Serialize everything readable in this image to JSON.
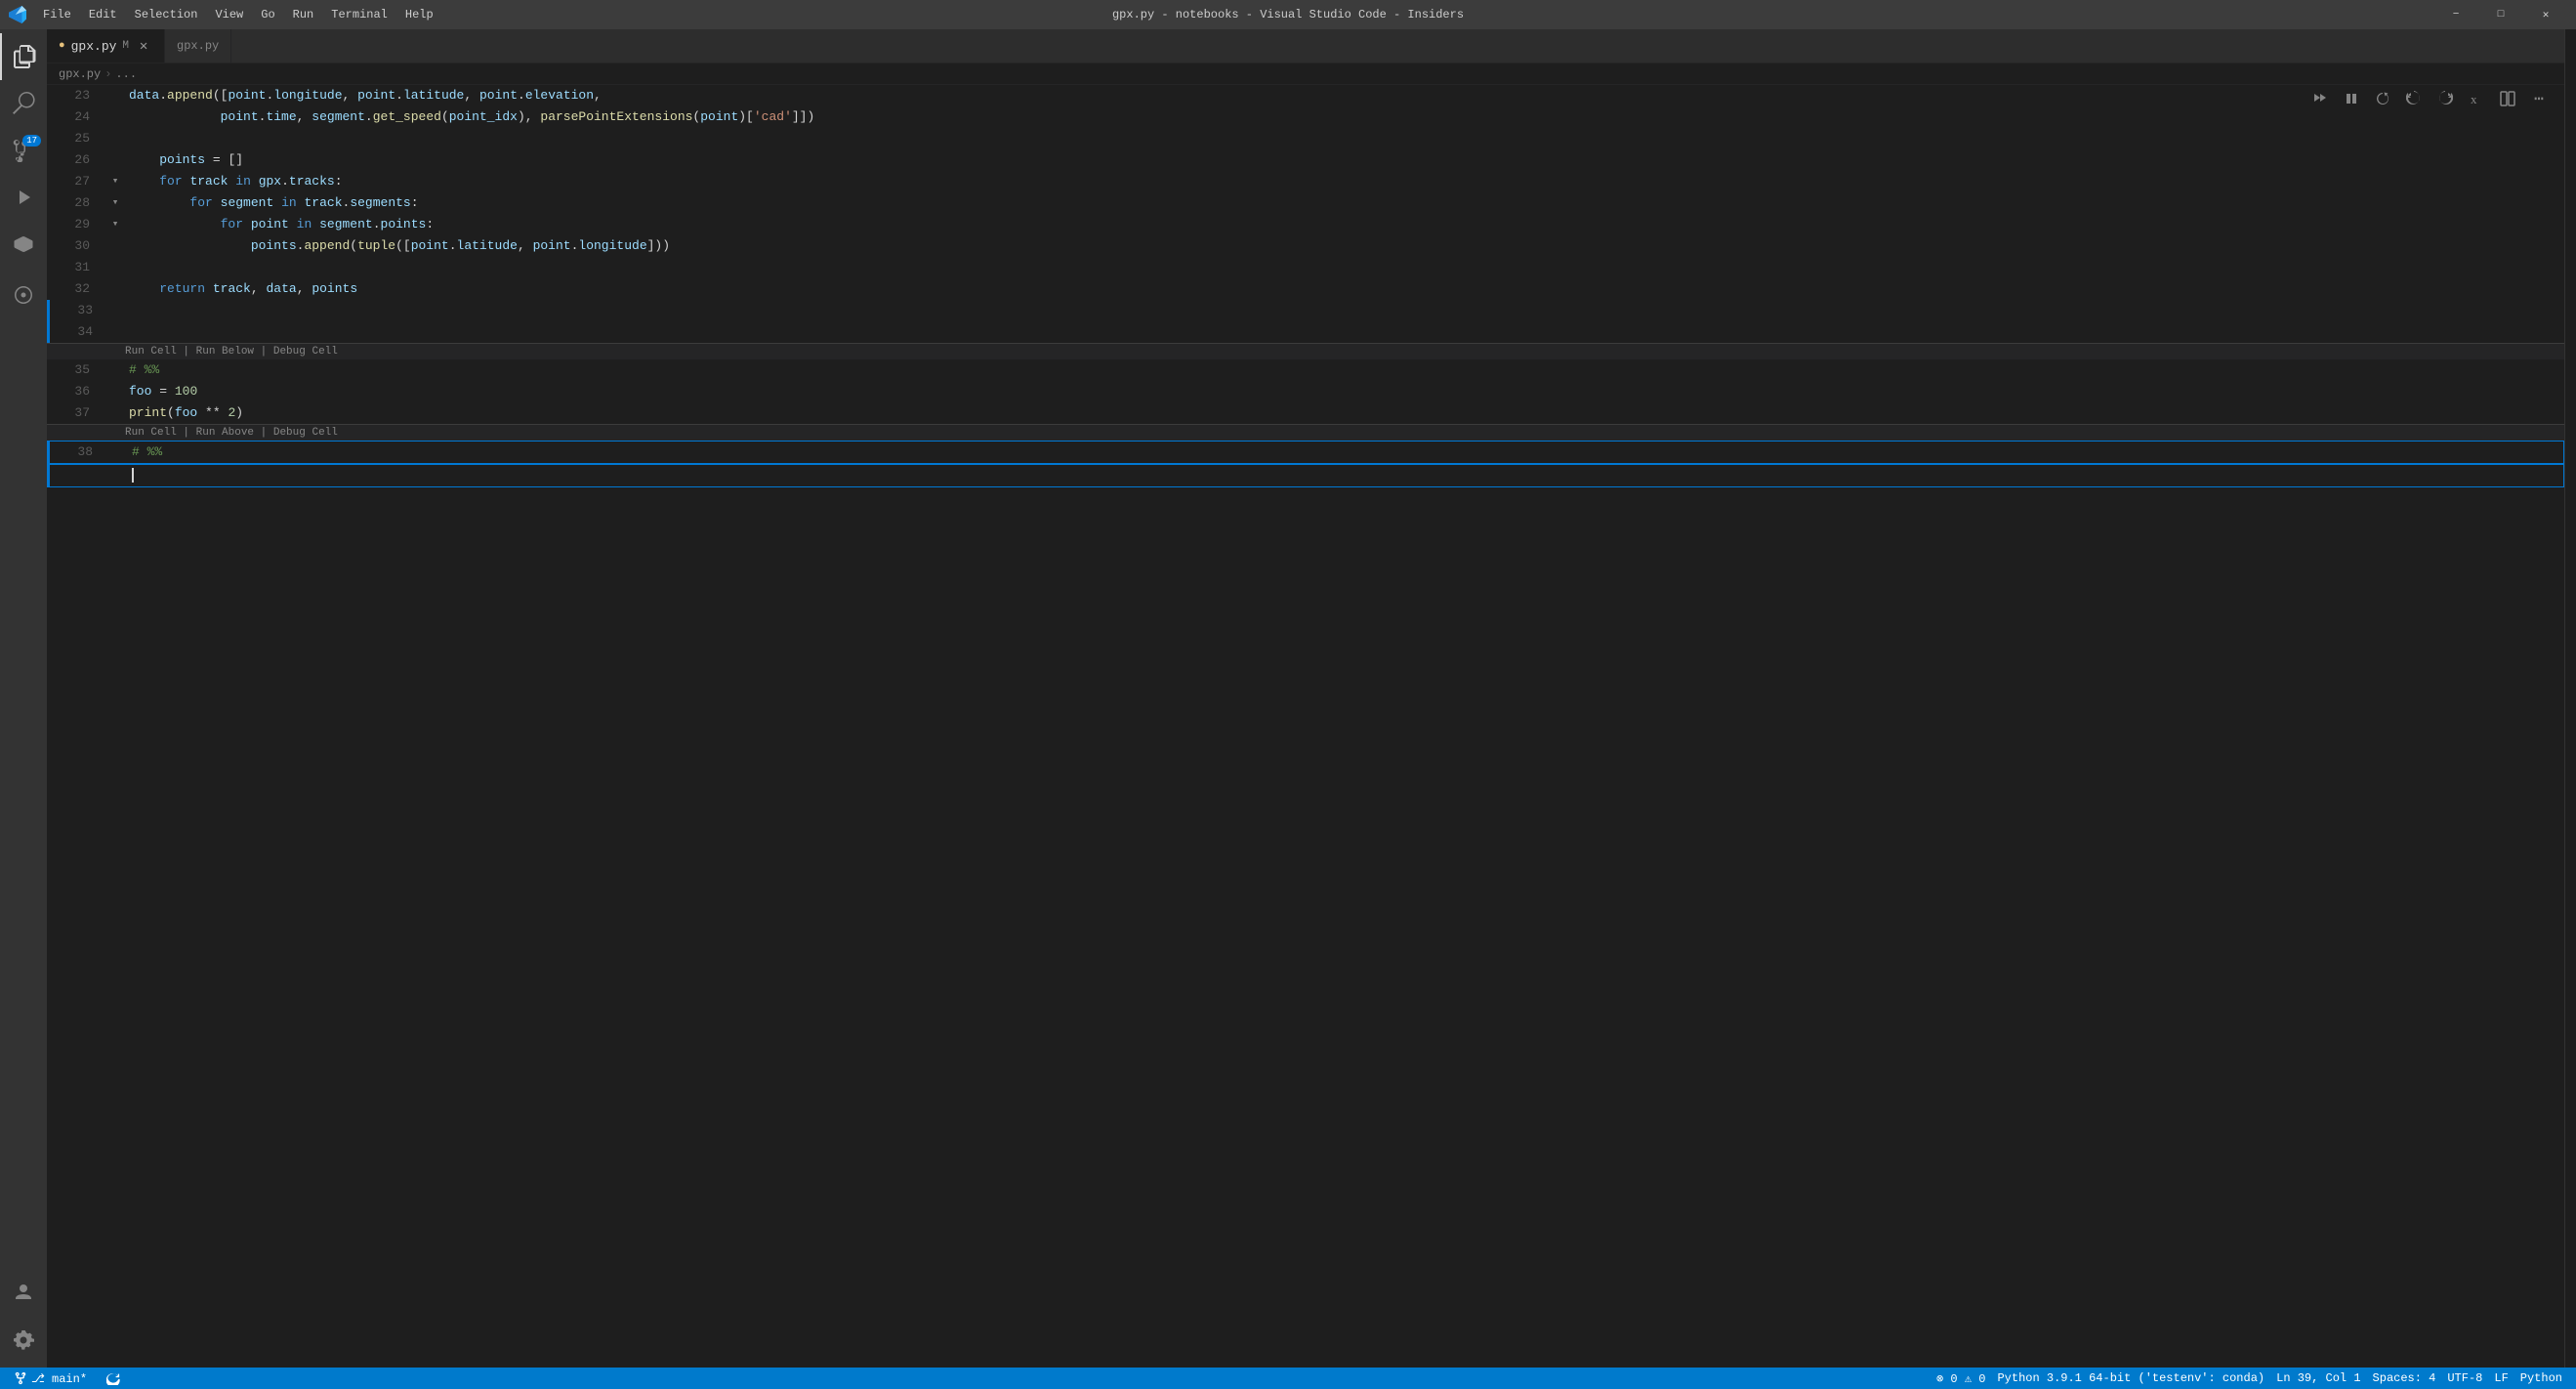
{
  "window": {
    "title": "gpx.py - notebooks - Visual Studio Code - Insiders"
  },
  "titlebar": {
    "menu_items": [
      "File",
      "Edit",
      "Selection",
      "View",
      "Go",
      "Run",
      "Terminal",
      "Help"
    ],
    "controls": [
      "−",
      "□",
      "×"
    ]
  },
  "activity_bar": {
    "icons": [
      {
        "name": "explorer-icon",
        "symbol": "⎘",
        "active": true
      },
      {
        "name": "search-icon",
        "symbol": "🔍",
        "active": false
      },
      {
        "name": "source-control-icon",
        "symbol": "⎇",
        "active": false,
        "badge": "17"
      },
      {
        "name": "run-debug-icon",
        "symbol": "▶",
        "active": false
      },
      {
        "name": "extensions-icon",
        "symbol": "⧉",
        "active": false
      },
      {
        "name": "remote-explorer-icon",
        "symbol": "⊞",
        "active": false
      }
    ],
    "bottom_icons": [
      {
        "name": "accounts-icon",
        "symbol": "👤"
      },
      {
        "name": "settings-icon",
        "symbol": "⚙"
      }
    ]
  },
  "tabs": [
    {
      "label": "gpx.py",
      "modifier": "M",
      "active": true,
      "modified": false
    },
    {
      "label": "gpx.py",
      "active": false
    }
  ],
  "breadcrumb": {
    "parts": [
      "gpx.py",
      "..."
    ]
  },
  "toolbar": {
    "buttons": [
      {
        "name": "run-all-button",
        "symbol": "▶▶"
      },
      {
        "name": "interrupt-button",
        "symbol": "⏸"
      },
      {
        "name": "restart-button",
        "symbol": "↺"
      },
      {
        "name": "undo-button",
        "symbol": "↩"
      },
      {
        "name": "redo-button",
        "symbol": "↪"
      },
      {
        "name": "variables-button",
        "symbol": "x"
      },
      {
        "name": "split-editor-button",
        "symbol": "⊟"
      },
      {
        "name": "more-actions-button",
        "symbol": "⋯"
      }
    ]
  },
  "code": {
    "lines": [
      {
        "num": 23,
        "gutter": "",
        "content": "data.append([point.longitude, point.latitude, point.elevation,",
        "active_border": false
      },
      {
        "num": 24,
        "gutter": "",
        "content": "            point.time, segment.get_speed(point_idx), parsePointExtensions(point)['cad']])",
        "active_border": false
      },
      {
        "num": 25,
        "gutter": "",
        "content": "",
        "active_border": false
      },
      {
        "num": 26,
        "gutter": "",
        "content": "    points = []",
        "active_border": false
      },
      {
        "num": 27,
        "gutter": "▾",
        "content": "    for track in gpx.tracks:",
        "active_border": false
      },
      {
        "num": 28,
        "gutter": "▾",
        "content": "        for segment in track.segments:",
        "active_border": false
      },
      {
        "num": 29,
        "gutter": "▾",
        "content": "            for point in segment.points:",
        "active_border": false
      },
      {
        "num": 30,
        "gutter": "",
        "content": "                points.append(tuple([point.latitude, point.longitude]))",
        "active_border": false
      },
      {
        "num": 31,
        "gutter": "",
        "content": "",
        "active_border": false
      },
      {
        "num": 32,
        "gutter": "",
        "content": "    return track, data, points",
        "active_border": false
      },
      {
        "num": 33,
        "gutter": "",
        "content": "",
        "active_border": true
      },
      {
        "num": 34,
        "gutter": "",
        "content": "",
        "active_border": true
      }
    ],
    "cell1_separator": "Run Cell | Run Below | Debug Cell",
    "cell1_lines": [
      {
        "num": 35,
        "content": "# %%",
        "is_cell_marker": true
      },
      {
        "num": 36,
        "content": "foo = 100"
      },
      {
        "num": 37,
        "content": "print(foo ** 2)"
      }
    ],
    "cell2_separator_top": "Run Cell | Run Above | Debug Cell",
    "cell2_lines": [
      {
        "num": 38,
        "content": "# %%",
        "is_cell_marker": true
      }
    ]
  },
  "status_bar": {
    "left": [
      {
        "name": "branch-status",
        "text": "⎇ main*"
      },
      {
        "name": "sync-status",
        "text": "↻"
      }
    ],
    "right": [
      {
        "name": "ln-col-status",
        "text": "Ln 39, Col 1"
      },
      {
        "name": "spaces-status",
        "text": "Spaces: 4"
      },
      {
        "name": "encoding-status",
        "text": "UTF-8"
      },
      {
        "name": "eol-status",
        "text": "LF"
      },
      {
        "name": "language-status",
        "text": "Python"
      },
      {
        "name": "errors-status",
        "text": "⊘ 0  ⚠ 0"
      },
      {
        "name": "python-version-status",
        "text": "Python 3.9.1 64-bit ('testenv': conda)"
      }
    ]
  }
}
